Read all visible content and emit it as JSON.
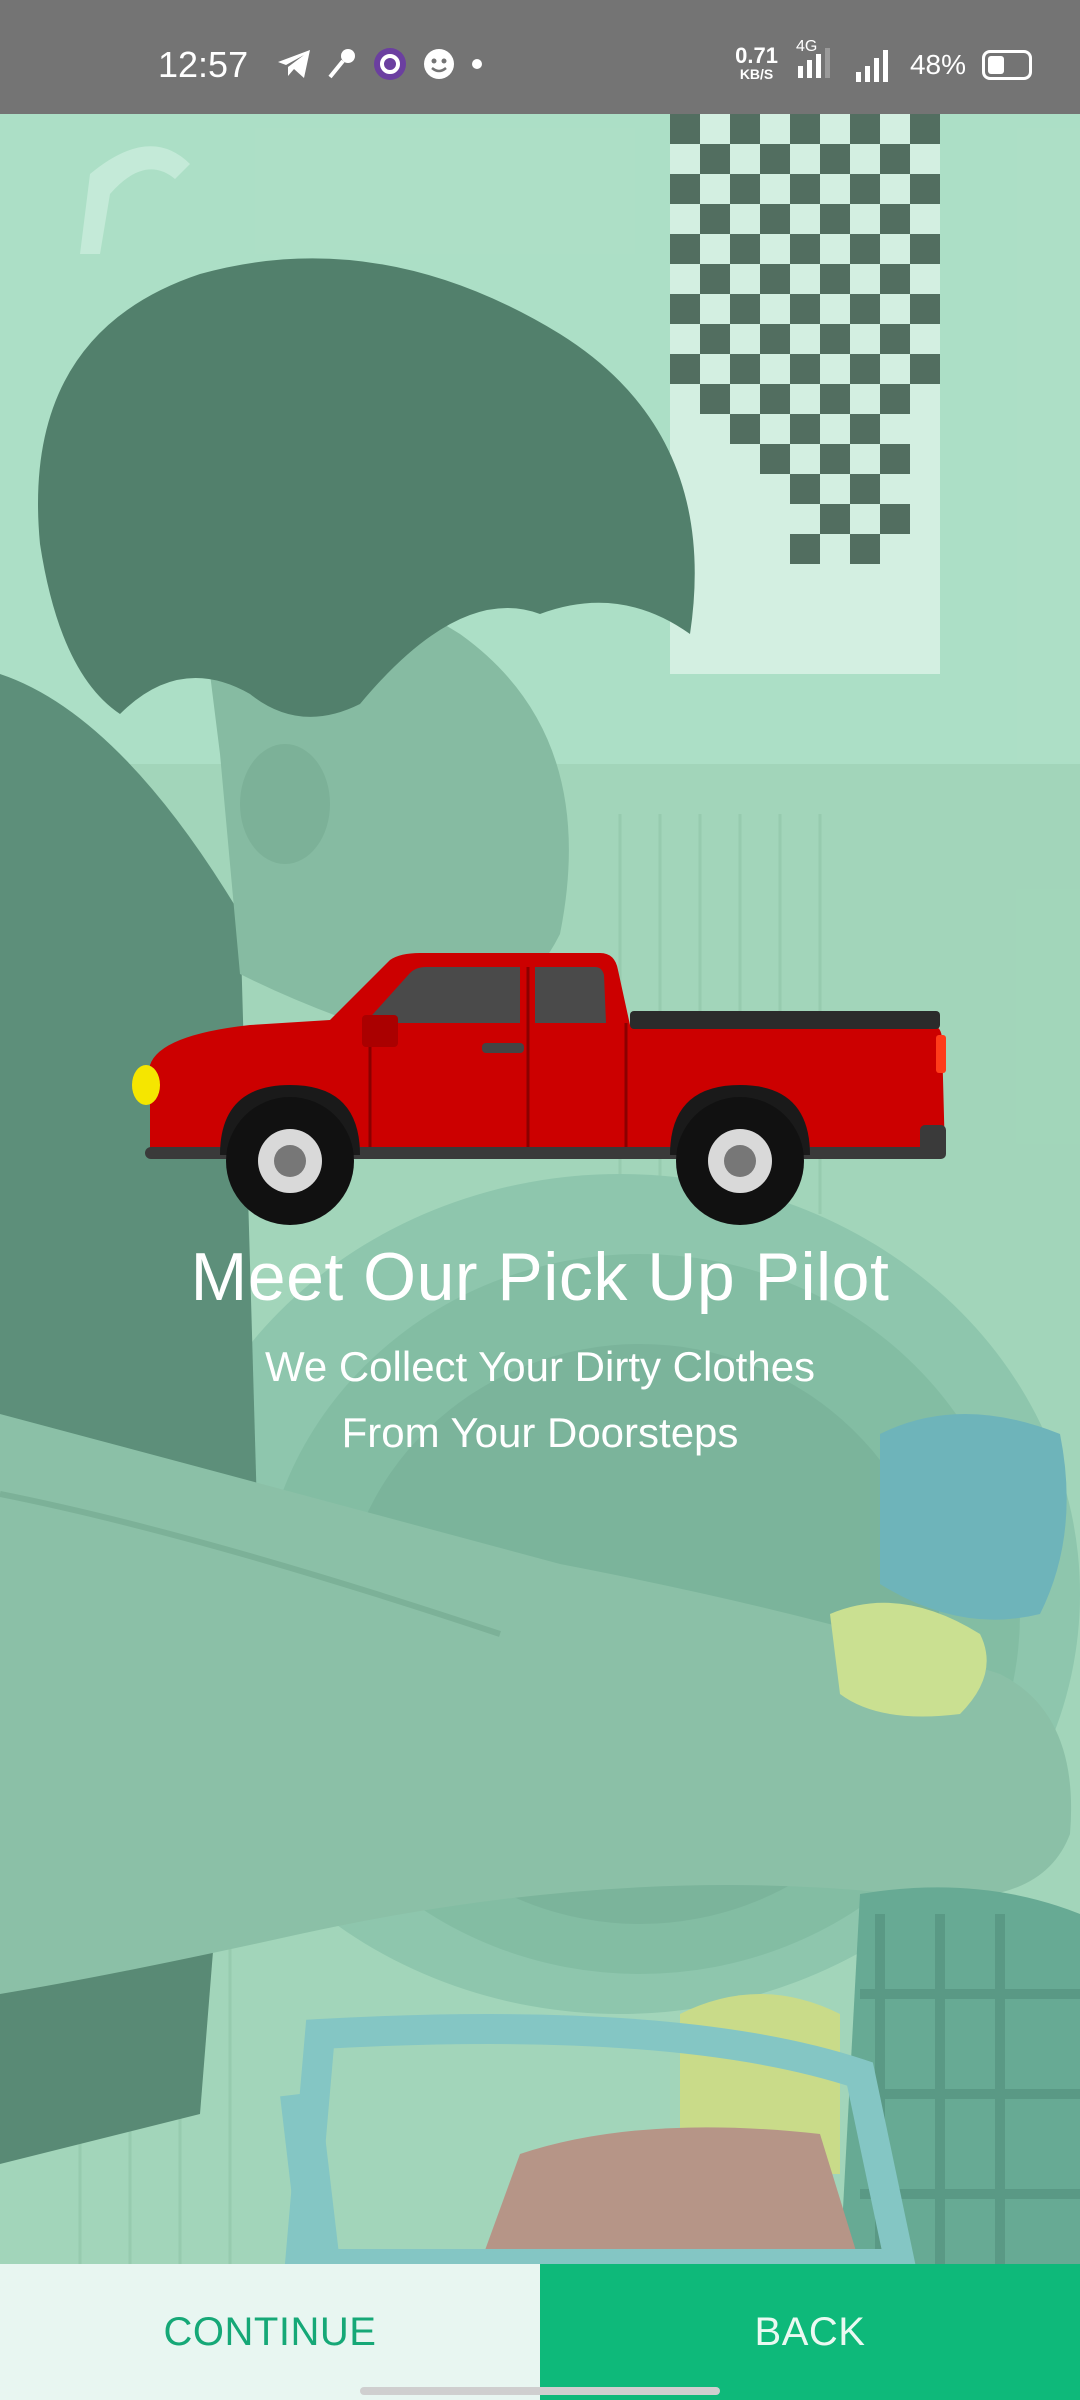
{
  "status_bar": {
    "time": "12:57",
    "net_speed_value": "0.71",
    "net_speed_unit": "KB/S",
    "network_type": "4G",
    "battery_percent": "48%"
  },
  "content": {
    "title": "Meet Our Pick Up Pilot",
    "subtitle_line1": "We Collect Your Dirty Clothes",
    "subtitle_line2": "From Your Doorsteps"
  },
  "buttons": {
    "continue_label": "CONTINUE",
    "back_label": "BACK"
  },
  "colors": {
    "accent": "#0eb97a",
    "truck_red": "#d40000"
  }
}
